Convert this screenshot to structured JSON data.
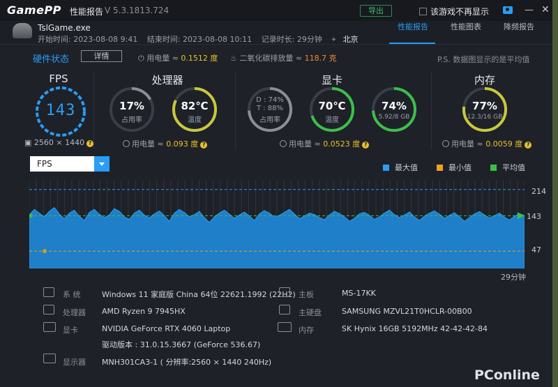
{
  "titlebar": {
    "logo": "GamePP",
    "title": "性能报告",
    "version": "V 5.3.1813.724",
    "export_label": "导出",
    "no_more_label": "该游戏不再显示"
  },
  "header": {
    "game": "TslGame.exe",
    "start": "开始时间: 2023-08-08 9:41",
    "end": "结束时间: 2023-08-08 10:11",
    "duration": "记录时长: 29分钟",
    "city": "北京",
    "tabs": [
      "性能报告",
      "性能图表",
      "降频报告"
    ]
  },
  "hardware": {
    "title": "硬件状态",
    "detail_label": "详情",
    "power_label": "用电量 ≈ ",
    "power_value": "0.1512 度",
    "co2_label": "二氧化碳排放量 ≈ ",
    "co2_value": "118.7 克",
    "ps_note": "P.S. 数据图显示的是平均值"
  },
  "fps": {
    "title": "FPS",
    "value": "143",
    "resolution": "2560 × 1440"
  },
  "cpu": {
    "title": "处理器",
    "usage": "17%",
    "usage_label": "占用率",
    "usage_fraction": 0.17,
    "temp": "82℃",
    "temp_label": "温度",
    "temp_fraction": 0.82,
    "power_label": "用电量 ≈ ",
    "power_value": "0.093 度"
  },
  "gpu": {
    "title": "显卡",
    "d_usage": "D : 74%",
    "t_usage": "T : 88%",
    "usage_label": "占用率",
    "temp": "70℃",
    "temp_label": "温度",
    "temp_fraction": 0.7,
    "mem": "74%",
    "mem_sub": "5.92/8 GB",
    "mem_fraction": 0.74,
    "power_label": "用电量 ≈ ",
    "power_value": "0.0523 度"
  },
  "ram": {
    "title": "内存",
    "usage": "77%",
    "usage_sub": "12.3/16 GB",
    "usage_fraction": 0.77,
    "power_label": "用电量 ≈ ",
    "power_value": "0.0059 度"
  },
  "chart": {
    "selector": "FPS",
    "legend": [
      {
        "label": "最大值",
        "color": "#2a9df4"
      },
      {
        "label": "最小值",
        "color": "#f0a020"
      },
      {
        "label": "平均值",
        "color": "#3cbf4a"
      }
    ],
    "duration_label": "29分钟"
  },
  "chart_data": {
    "type": "area",
    "title": "",
    "series": [
      {
        "name": "FPS",
        "values": [
          145,
          160,
          150,
          140,
          155,
          165,
          148,
          135,
          150,
          158,
          142,
          130,
          152,
          160,
          147,
          138,
          145,
          162,
          155,
          140,
          133,
          150,
          158,
          145,
          137,
          148,
          156,
          143,
          128,
          150,
          160,
          152,
          140,
          146,
          155,
          138,
          125,
          140,
          150,
          158,
          147,
          136,
          145,
          153,
          142,
          130,
          148,
          157,
          150,
          139,
          144,
          152,
          160,
          148,
          135,
          142,
          150,
          146,
          138,
          132,
          145,
          155,
          149,
          140,
          128,
          136,
          148,
          152,
          144,
          133,
          140,
          150,
          158,
          146,
          138,
          145,
          153,
          140,
          130,
          142,
          150,
          156,
          147,
          136,
          144,
          151,
          140,
          128,
          138,
          148,
          154,
          145,
          137,
          143,
          150,
          139,
          131,
          142,
          149,
          143
        ]
      }
    ],
    "reference_lines": {
      "max": 214,
      "avg": 143,
      "min": 47
    },
    "ylim": [
      0,
      240
    ],
    "xlabel": "29分钟"
  },
  "system": {
    "os_key": "系  统",
    "os_val": "Windows 11 家庭版 China 64位 22621.1992 (22H2)",
    "cpu_key": "处理器",
    "cpu_val": "AMD Ryzen 9 7945HX",
    "gpu_key": "显卡",
    "gpu_val": "NVIDIA GeForce RTX 4060 Laptop",
    "driver_val": "驱动版本 : 31.0.15.3667 (GeForce 536.67)",
    "display_key": "显示器",
    "display_val": "MNH301CA3-1 ( 分辨率:2560 × 1440 240Hz)",
    "board_key": "主板",
    "board_val": "MS-17KK",
    "disk_key": "主硬盘",
    "disk_val": "SAMSUNG MZVL21T0HCLR-00B00",
    "mem_key": "内存",
    "mem_val": "SK Hynix 16GB 5192MHz 42-42-42-84"
  },
  "watermark": "PConline",
  "colors": {
    "accent": "#2a9df4",
    "ring_ok": "#3cbf4a",
    "ring_warn": "#c8c83c",
    "energy": "#e8c22a"
  }
}
